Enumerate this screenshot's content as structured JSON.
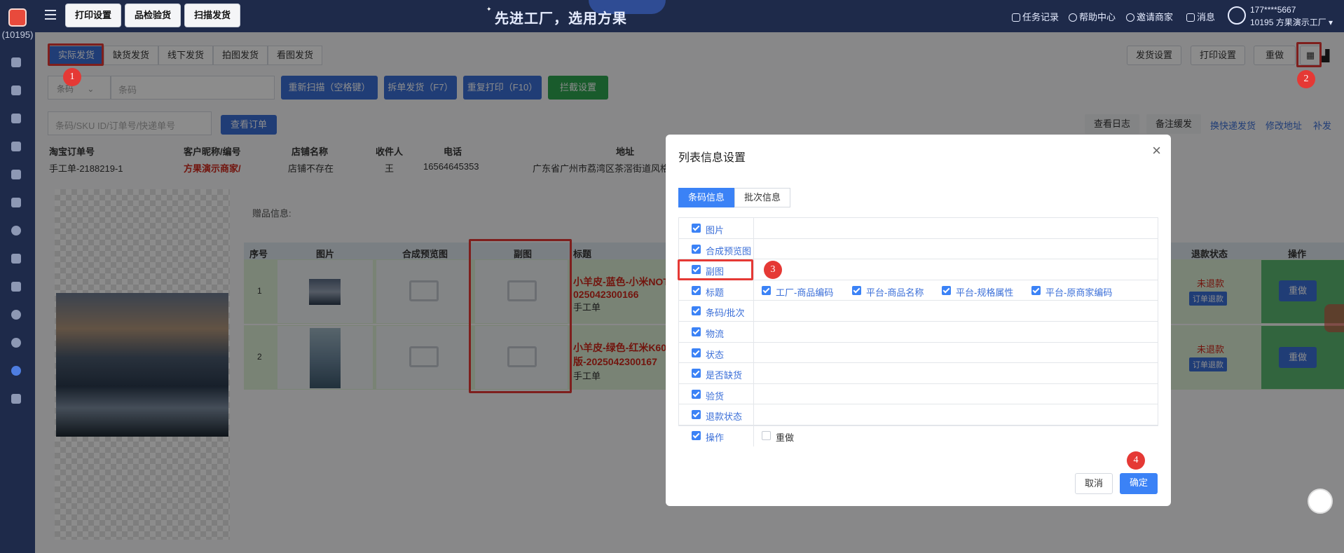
{
  "sidebar": {
    "count_label": "(10195)"
  },
  "topbar": {
    "buttons": [
      "打印设置",
      "品检验货",
      "扫描发货"
    ],
    "slogan": "先进工厂，选用方果",
    "links": [
      "任务记录",
      "帮助中心",
      "邀请商家",
      "消息"
    ],
    "user_phone": "177****5667",
    "user_name": "10195 方果演示工厂"
  },
  "tabs": [
    "实际发货",
    "缺货发货",
    "线下发货",
    "拍图发货",
    "看图发货"
  ],
  "right_buttons": [
    "发货设置",
    "打印设置",
    "重做"
  ],
  "scan": {
    "select_value": "条码",
    "barcode_placeholder": "条码",
    "buttons": [
      "重新扫描（空格键）",
      "拆单发货（F7）",
      "重复打印（F10）",
      "拦截设置"
    ],
    "order_placeholder": "条码/SKU ID/订单号/快递单号",
    "view_order": "查看订单"
  },
  "actions": {
    "gray": [
      "查看日志",
      "备注缓发"
    ],
    "links": [
      "换快递发货",
      "修改地址",
      "补发"
    ]
  },
  "order": {
    "headers": [
      "淘宝订单号",
      "客户昵称/编号",
      "店铺名称",
      "收件人",
      "电话",
      "地址"
    ],
    "values": [
      "手工单-2188219-1",
      "方果演示商家/",
      "店铺不存在",
      "王",
      "16564645353",
      "广东省广州市荔湾区茶滘街道风格"
    ]
  },
  "gift_label": "赠品信息:",
  "items": {
    "headers": [
      "序号",
      "图片",
      "合成预览图",
      "副图",
      "标题",
      "退款状态",
      "操作"
    ],
    "rows": [
      {
        "no": "1",
        "title1": "小羊皮-蓝色-小米NOT",
        "title2": "025042300166",
        "sub": "手工单",
        "refund": "未退款",
        "refund_tag": "订单退款",
        "op": "重做"
      },
      {
        "no": "2",
        "title1": "小羊皮-绿色-红米K60",
        "title2": "版-2025042300167",
        "sub": "手工单",
        "refund": "未退款",
        "refund_tag": "订单退款",
        "op": "重做"
      }
    ]
  },
  "modal": {
    "title": "列表信息设置",
    "tabs": [
      "条码信息",
      "批次信息"
    ],
    "rows": [
      {
        "label": "图片",
        "checked": true,
        "options": []
      },
      {
        "label": "合成预览图",
        "checked": true,
        "options": []
      },
      {
        "label": "副图",
        "checked": true,
        "options": []
      },
      {
        "label": "标题",
        "checked": true,
        "options": [
          "工厂-商品编码",
          "平台-商品名称",
          "平台-规格属性",
          "平台-原商家编码"
        ]
      },
      {
        "label": "条码/批次",
        "checked": true,
        "options": []
      },
      {
        "label": "物流",
        "checked": true,
        "options": []
      },
      {
        "label": "状态",
        "checked": true,
        "options": []
      },
      {
        "label": "是否缺货",
        "checked": true,
        "options": []
      },
      {
        "label": "验货",
        "checked": true,
        "options": []
      },
      {
        "label": "退款状态",
        "checked": true,
        "options": []
      },
      {
        "label": "操作",
        "checked": true,
        "options": [
          "重做"
        ]
      }
    ],
    "cancel": "取消",
    "confirm": "确定"
  },
  "badges": [
    "1",
    "2",
    "3",
    "4"
  ],
  "colors": {
    "primary": "#3b6fd8",
    "nav": "#1e2a4a",
    "annotation": "#e53935",
    "success": "#2fa650",
    "row_bg": "#dcefd5"
  }
}
